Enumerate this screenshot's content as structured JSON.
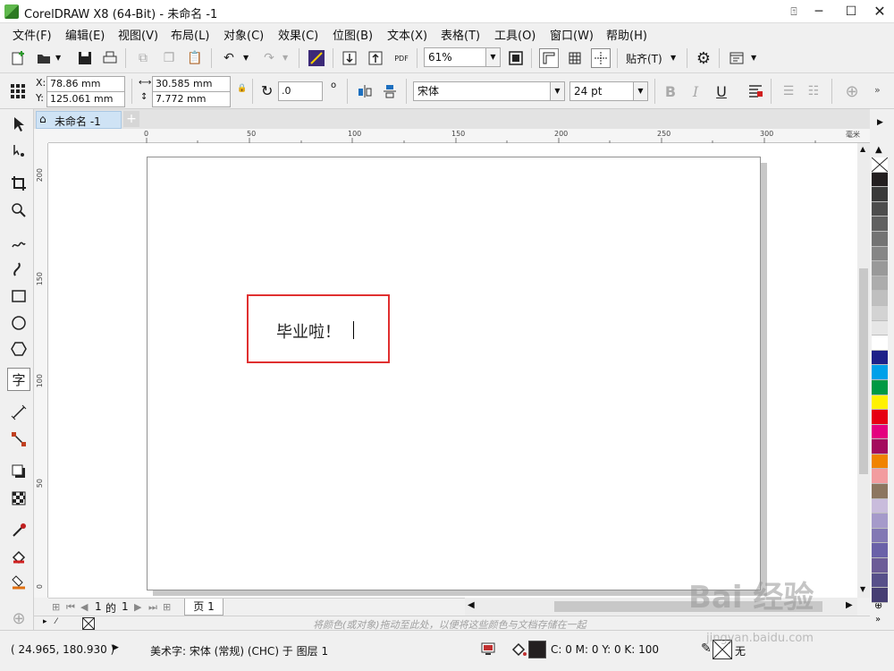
{
  "window": {
    "title": "CorelDRAW X8 (64-Bit) - 未命名 -1"
  },
  "menu": [
    "文件(F)",
    "编辑(E)",
    "视图(V)",
    "布局(L)",
    "对象(C)",
    "效果(C)",
    "位图(B)",
    "文本(X)",
    "表格(T)",
    "工具(O)",
    "窗口(W)",
    "帮助(H)"
  ],
  "toolbar": {
    "zoom": "61%",
    "snap_label": "贴齐(T)"
  },
  "property_bar": {
    "x_label": "X:",
    "x_value": "78.86 mm",
    "y_label": "Y:",
    "y_value": "125.061 mm",
    "width": "30.585 mm",
    "height": "7.772 mm",
    "rotation": ".0",
    "rotation_unit": "o",
    "font_name": "宋体",
    "font_size": "24 pt"
  },
  "document": {
    "tab": "未命名 -1",
    "text": "毕业啦！",
    "page_label": "页 1",
    "page_current": "1",
    "page_of": "的",
    "page_total": "1"
  },
  "rulers": {
    "unit": "毫米",
    "h_ticks": [
      "0",
      "50",
      "100",
      "150",
      "200",
      "250",
      "300"
    ],
    "v_ticks": [
      "200",
      "150",
      "100",
      "50",
      "0"
    ]
  },
  "palette": {
    "colors": [
      "#231f20",
      "#3a3a3a",
      "#4d4d4d",
      "#606060",
      "#737373",
      "#868686",
      "#999999",
      "#acacac",
      "#bfbfbf",
      "#d3d3d3",
      "#e6e6e6",
      "#ffffff",
      "#1d2088",
      "#00a0e9",
      "#009944",
      "#fff100",
      "#e60012",
      "#e4007f",
      "#a40b5d",
      "#f08300",
      "#f29c9f",
      "#8c7660",
      "#c9bcdc",
      "#a59aca",
      "#8278b4",
      "#6a61a8",
      "#6c5c97",
      "#57508a",
      "#463e73"
    ]
  },
  "docpal_hint": "将颜色(或对象)拖动至此处，以便将这些颜色与文档存储在一起",
  "status": {
    "coords": "( 24.965, 180.930 )",
    "info": "美术字: 宋体 (常规) (CHC) 于 图层 1",
    "fill": "C: 0 M: 0 Y: 0 K: 100",
    "outline": "无"
  },
  "watermark": {
    "brand": "Bai 经验",
    "url": "jingyan.baidu.com"
  }
}
